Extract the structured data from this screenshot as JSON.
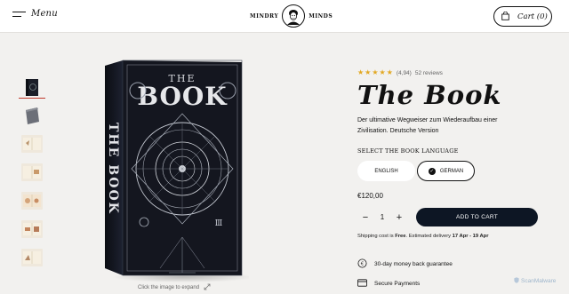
{
  "header": {
    "menu_label": "Menu",
    "logo_left": "MINDRY",
    "logo_right": "MINDS",
    "cart_label": "Cart (0)"
  },
  "gallery": {
    "thumbnail_count": 7,
    "active_thumbnail": 1,
    "book_spine_text": "THE BOOK",
    "book_cover_title": "THE BOOK",
    "expand_hint": "Click the image to expand"
  },
  "product": {
    "stars": 5,
    "rating_value": "(4,94)",
    "review_count": "52 reviews",
    "title": "The Book",
    "description": "Der ultimative Wegweiser zum Wiederaufbau einer Zivilisation. Deutsche Version",
    "language_label": "SELECT THE BOOK LANGUAGE",
    "languages": [
      {
        "label": "ENGLISH",
        "selected": false
      },
      {
        "label": "GERMAN",
        "selected": true
      }
    ],
    "price": "€120,00",
    "quantity": "1",
    "add_to_cart": "ADD TO CART",
    "shipping_prefix": "Shipping cost is ",
    "shipping_free": "Free",
    "shipping_mid": ". Estimated delivery ",
    "delivery_window": "17 Apr - 19 Apr",
    "features": [
      {
        "icon": "money-back-icon",
        "label": "30-day money back guarantee"
      },
      {
        "icon": "credit-card-icon",
        "label": "Secure Payments"
      }
    ]
  },
  "watermark": "ScanMalware",
  "colors": {
    "accent_dark": "#0d1624",
    "star": "#e2a822",
    "background": "#f2f1ef"
  }
}
